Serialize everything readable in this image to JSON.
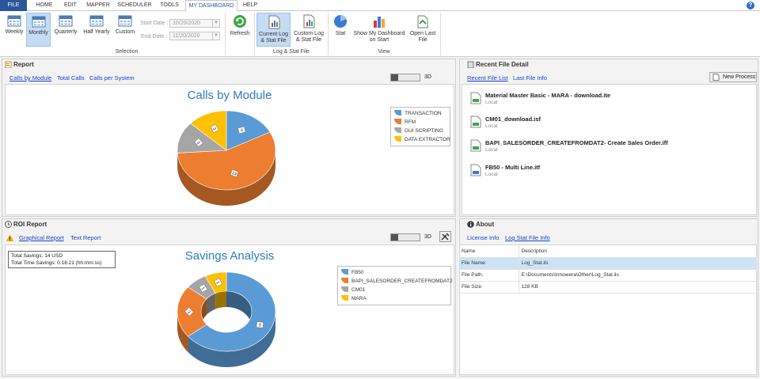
{
  "menu": {
    "file": "FILE",
    "tabs": [
      "HOME",
      "EDIT",
      "MAPPER",
      "SCHEDULER",
      "TOOLS",
      "MY DASHBOARD",
      "HELP"
    ],
    "help_icon": "?"
  },
  "ribbon": {
    "selection": {
      "weekly": "Weekly",
      "monthly": "Monthly",
      "quarterly": "Quarterly",
      "half_yearly": "Half Yearly",
      "custom": "Custom",
      "start_date_label": "Start Date :",
      "start_date_value": "10/20/2020",
      "end_date_label": "End Date :",
      "end_date_value": "11/20/2020",
      "group_label": "Selection"
    },
    "refresh": "Refresh",
    "log_stat": {
      "current_line1": "Current Log",
      "current_line2": "& Stat File",
      "custom_line1": "Custom Log",
      "custom_line2": "& Stat File",
      "group_label": "Log & Stat File"
    },
    "view": {
      "stat": "Stat",
      "show_line1": "Show My Dashboard",
      "show_line2": "on Start",
      "open_line1": "Open Last",
      "open_line2": "File",
      "group_label": "View"
    }
  },
  "report": {
    "title": "Report",
    "links": [
      "Calls by Module",
      "Total Calls",
      "Calls per System"
    ],
    "toggle_label": "3D",
    "chart_title": "Calls by Module"
  },
  "roi": {
    "title": "ROI Report",
    "links": [
      "Graphical Report",
      "Text Report"
    ],
    "toggle_label": "3D",
    "chart_title": "Savings Analysis",
    "total_savings": "Total Savings: 14 USD",
    "total_time": "Total Time Savings: 0:16:21 (hh:mm:ss)"
  },
  "recent": {
    "title": "Recent File Detail",
    "links": [
      "Recent File List",
      "Last File Info"
    ],
    "new_process": "New Process",
    "files": [
      {
        "name": "Material Master Basic - MARA - download.ite",
        "location": "Local"
      },
      {
        "name": "CM01_download.isf",
        "location": "Local"
      },
      {
        "name": "BAPI_SALESORDER_CREATEFROMDAT2- Create Sales Order.iff",
        "location": "Local"
      },
      {
        "name": "FB50 - Multi Line.itf",
        "location": "Local"
      }
    ]
  },
  "about": {
    "title": "About",
    "links": [
      "License Info",
      "Log Stat File Info"
    ],
    "headers": [
      "Name",
      "Description"
    ],
    "rows": [
      [
        "File Name:",
        "Log_Stat.ils"
      ],
      [
        "File Path:",
        "E:\\Documents\\Innowera\\Other\\Log_Stat.ils"
      ],
      [
        "File Size:",
        "128 KB"
      ]
    ]
  },
  "chart_data": [
    {
      "type": "pie",
      "title": "Calls by Module",
      "categories": [
        "TRANSACTION",
        "RFM",
        "GUI SCRIPTING",
        "DATA EXTRACTOR"
      ],
      "values": [
        4,
        13,
        3,
        3
      ],
      "colors": [
        "#5b9bd5",
        "#ed7d31",
        "#a5a5a5",
        "#ffc000"
      ],
      "legend": "top-right",
      "three_d": true
    },
    {
      "type": "pie",
      "subtype": "doughnut",
      "title": "Savings Analysis",
      "categories": [
        "FB50",
        "BAPI_SALESORDER_CREATEFROMDAT2",
        "CM01",
        "MARA"
      ],
      "values": [
        9,
        3,
        1,
        1
      ],
      "colors": [
        "#5b9bd5",
        "#ed7d31",
        "#a5a5a5",
        "#ffc000"
      ],
      "legend": "top-right",
      "three_d": true
    }
  ]
}
